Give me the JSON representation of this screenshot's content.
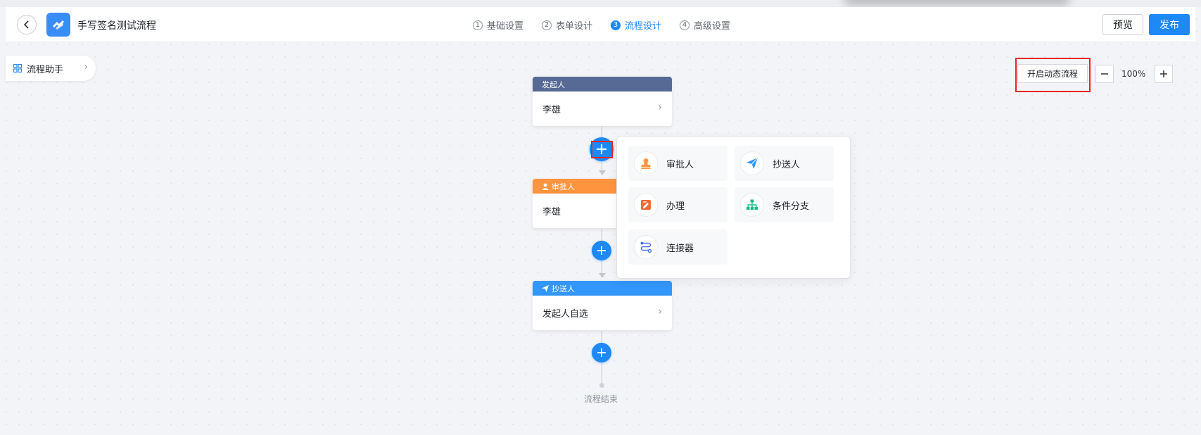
{
  "header": {
    "back_icon": "arrow-left-icon",
    "app_title": "手写签名测试流程",
    "steps": [
      {
        "num": "1",
        "label": "基础设置"
      },
      {
        "num": "2",
        "label": "表单设计"
      },
      {
        "num": "3",
        "label": "流程设计"
      },
      {
        "num": "4",
        "label": "高级设置"
      }
    ],
    "active_step": 3,
    "preview_label": "预览",
    "publish_label": "发布"
  },
  "assistant": {
    "label": "流程助手",
    "icon": "grid-icon"
  },
  "toolbar": {
    "dynamic_label": "开启动态流程",
    "zoom": "100%"
  },
  "flow": {
    "initiator": {
      "title": "发起人",
      "value": "李雄",
      "color": "#576a95"
    },
    "approver": {
      "title": "审批人",
      "value": "李雄",
      "color": "#ff943e"
    },
    "cc": {
      "title": "抄送人",
      "value": "发起人自选",
      "color": "#3296fa"
    },
    "end_label": "流程结束"
  },
  "popover": {
    "options": [
      {
        "label": "审批人",
        "icon": "approver-stamp-icon",
        "color": "#ff943e"
      },
      {
        "label": "抄送人",
        "icon": "send-plane-icon",
        "color": "#3296fa"
      },
      {
        "label": "办理",
        "icon": "edit-document-icon",
        "color": "#ee6a31"
      },
      {
        "label": "条件分支",
        "icon": "branch-tree-icon",
        "color": "#15bc83"
      },
      {
        "label": "连接器",
        "icon": "connector-icon",
        "color": "#4a6cf7"
      }
    ]
  },
  "colors": {
    "accent": "#1e88f5",
    "highlight": "#e8262a"
  }
}
